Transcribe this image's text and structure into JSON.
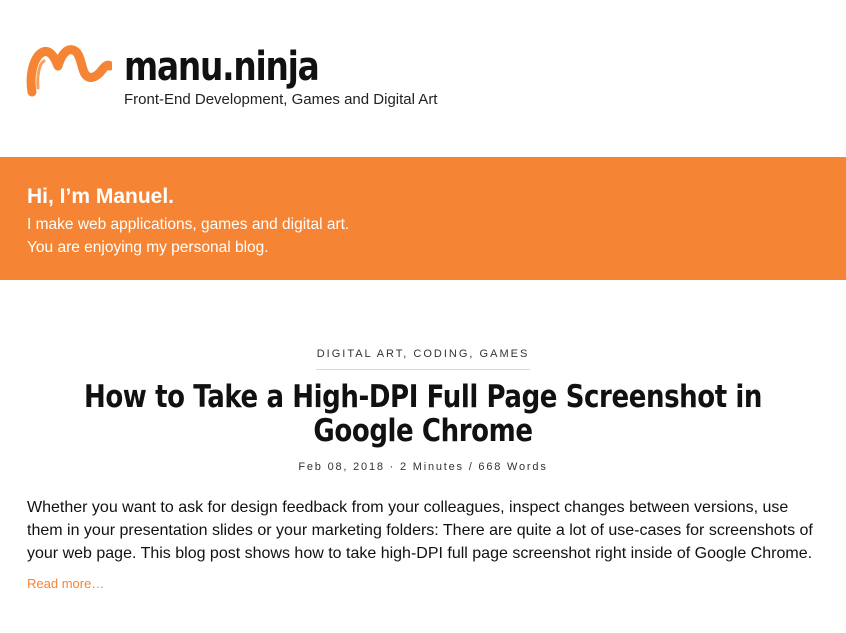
{
  "header": {
    "site_title": "manu.ninja",
    "tagline": "Front-End Development, Games and Digital Art",
    "logo_icon": "orange-brush-m-logo"
  },
  "intro": {
    "heading": "Hi, I’m Manuel.",
    "line1": "I make web applications, games and digital art.",
    "line2": "You are enjoying my personal blog."
  },
  "post": {
    "categories": [
      "DIGITAL ART",
      "CODING",
      "GAMES"
    ],
    "title": "How to Take a High-DPI Full Page Screenshot in Google Chrome",
    "meta": "Feb 08, 2018 · 2 Minutes / 668 Words",
    "excerpt": "Whether you want to ask for design feedback from your colleagues, inspect changes between versions, use them in your presentation slides or your marketing folders: There are quite a lot of use-cases for screenshots of your web page. This blog post shows how to take high-DPI full page screenshot right inside of Google Chrome.",
    "read_more": "Read more…"
  },
  "colors": {
    "accent": "#f58534",
    "text": "#111111",
    "background": "#ffffff"
  }
}
